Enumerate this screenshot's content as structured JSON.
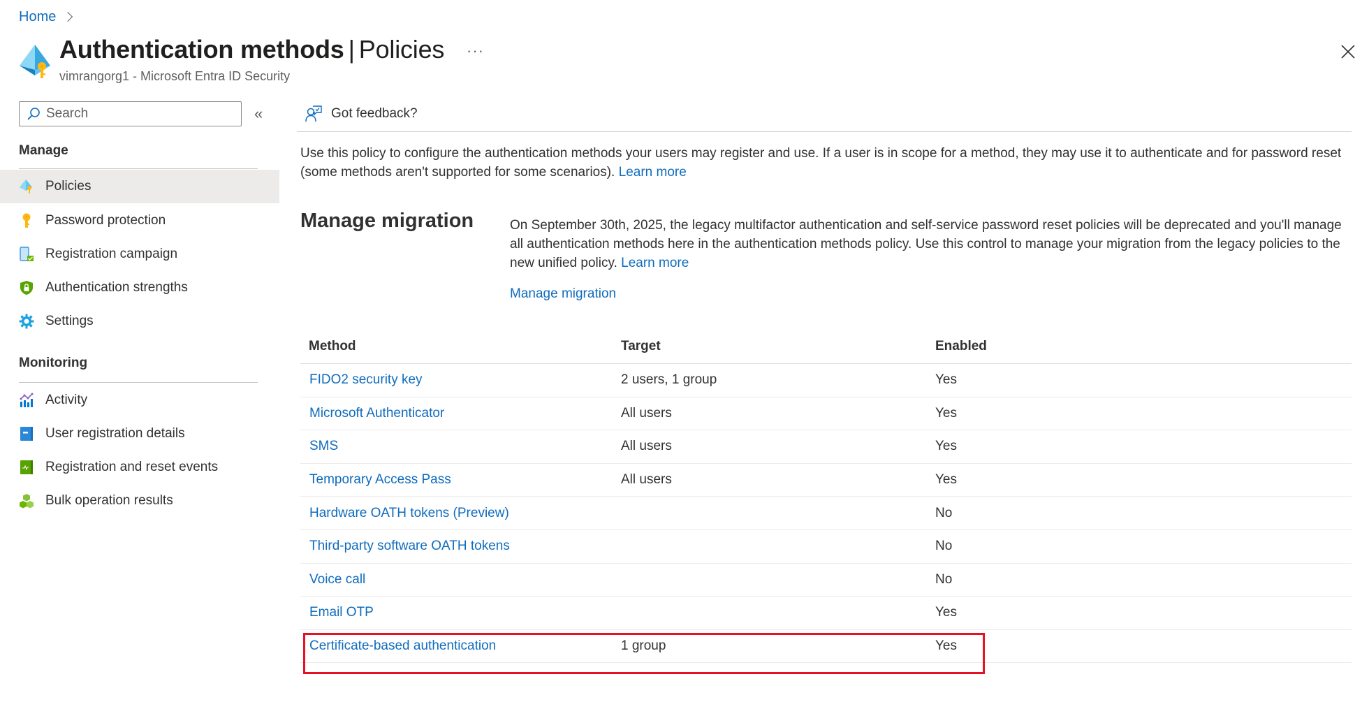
{
  "breadcrumb": {
    "items": [
      "Home"
    ]
  },
  "header": {
    "title": "Authentication methods",
    "divider": "|",
    "subtitle_section": "Policies",
    "more_label": "···",
    "org": "vimrangorg1 - Microsoft Entra ID Security",
    "page_icon": "authentication-methods-icon",
    "close_icon": "close-icon"
  },
  "sidebar": {
    "search": {
      "placeholder": "Search",
      "value": ""
    },
    "collapse_label": "«",
    "sections": [
      {
        "title": "Manage",
        "items": [
          {
            "label": "Policies",
            "icon": "policies-icon",
            "active": true
          },
          {
            "label": "Password protection",
            "icon": "key-icon",
            "active": false
          },
          {
            "label": "Registration campaign",
            "icon": "registration-campaign-icon",
            "active": false
          },
          {
            "label": "Authentication strengths",
            "icon": "shield-lock-icon",
            "active": false
          },
          {
            "label": "Settings",
            "icon": "gear-icon",
            "active": false
          }
        ]
      },
      {
        "title": "Monitoring",
        "items": [
          {
            "label": "Activity",
            "icon": "activity-chart-icon",
            "active": false
          },
          {
            "label": "User registration details",
            "icon": "user-registration-book-icon",
            "active": false
          },
          {
            "label": "Registration and reset events",
            "icon": "events-book-icon",
            "active": false
          },
          {
            "label": "Bulk operation results",
            "icon": "bulk-cubes-icon",
            "active": false
          }
        ]
      }
    ]
  },
  "toolbar": {
    "feedback_label": "Got feedback?",
    "feedback_icon": "feedback-icon"
  },
  "description": {
    "text": "Use this policy to configure the authentication methods your users may register and use. If a user is in scope for a method, they may use it to authenticate and for password reset (some methods aren't supported for some scenarios).",
    "link": "Learn more"
  },
  "migration": {
    "title": "Manage migration",
    "text": "On September 30th, 2025, the legacy multifactor authentication and self-service password reset policies will be deprecated and you'll manage all authentication methods here in the authentication methods policy. Use this control to manage your migration from the legacy policies to the new unified policy.",
    "learn_more": "Learn more",
    "action_link": "Manage migration"
  },
  "table": {
    "columns": [
      "Method",
      "Target",
      "Enabled"
    ],
    "rows": [
      {
        "method": "FIDO2 security key",
        "target": "2 users, 1 group",
        "enabled": "Yes"
      },
      {
        "method": "Microsoft Authenticator",
        "target": "All users",
        "enabled": "Yes"
      },
      {
        "method": "SMS",
        "target": "All users",
        "enabled": "Yes"
      },
      {
        "method": "Temporary Access Pass",
        "target": "All users",
        "enabled": "Yes"
      },
      {
        "method": "Hardware OATH tokens (Preview)",
        "target": "",
        "enabled": "No"
      },
      {
        "method": "Third-party software OATH tokens",
        "target": "",
        "enabled": "No"
      },
      {
        "method": "Voice call",
        "target": "",
        "enabled": "No"
      },
      {
        "method": "Email OTP",
        "target": "",
        "enabled": "Yes"
      },
      {
        "method": "Certificate-based authentication",
        "target": "1 group",
        "enabled": "Yes",
        "highlighted": true
      }
    ]
  },
  "colors": {
    "link": "#0f6cbd",
    "highlight_border": "#e81123",
    "active_nav_bg": "#edebe9"
  }
}
